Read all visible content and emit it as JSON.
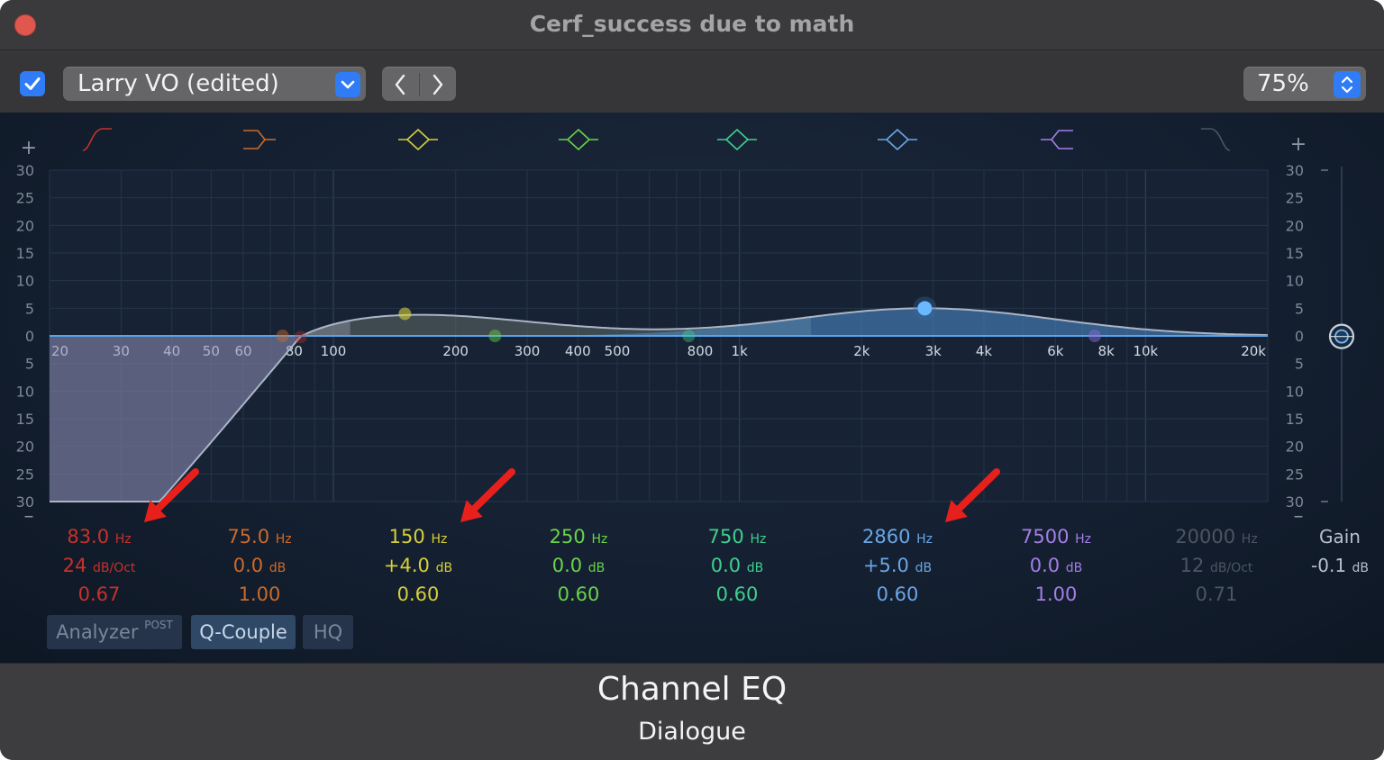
{
  "window": {
    "title": "Cerf_success due to math"
  },
  "toolbar": {
    "enabled": true,
    "preset": "Larry VO (edited)",
    "zoom": "75%"
  },
  "axis": {
    "db_left": [
      "30",
      "25",
      "20",
      "15",
      "10",
      "5",
      "0",
      "5",
      "10",
      "15",
      "20",
      "25",
      "30"
    ],
    "db_right": [
      "30",
      "25",
      "20",
      "15",
      "10",
      "5",
      "0",
      "5",
      "10",
      "15",
      "20",
      "25",
      "30"
    ],
    "plus": "+",
    "minus": "–",
    "freq_labels": [
      "20",
      "30",
      "40",
      "50",
      "60",
      "80",
      "100",
      "200",
      "300",
      "400",
      "500",
      "800",
      "1k",
      "2k",
      "3k",
      "4k",
      "6k",
      "8k",
      "10k",
      "20k"
    ]
  },
  "bands": [
    {
      "name": "Low Cut",
      "icon": "low-cut-icon",
      "color": "#c8312c",
      "freq": "83.0",
      "freq_unit": "Hz",
      "gain": "24",
      "gain_unit": "dB/Oct",
      "q": "0.67"
    },
    {
      "name": "Low Shelf",
      "icon": "low-shelf-icon",
      "color": "#cc6a2a",
      "freq": "75.0",
      "freq_unit": "Hz",
      "gain": "0.0",
      "gain_unit": "dB",
      "q": "1.00"
    },
    {
      "name": "Bell 1",
      "icon": "bell-icon",
      "color": "#d6cf3a",
      "freq": "150",
      "freq_unit": "Hz",
      "gain": "+4.0",
      "gain_unit": "dB",
      "q": "0.60"
    },
    {
      "name": "Bell 2",
      "icon": "bell-icon",
      "color": "#6ad24a",
      "freq": "250",
      "freq_unit": "Hz",
      "gain": "0.0",
      "gain_unit": "dB",
      "q": "0.60"
    },
    {
      "name": "Bell 3",
      "icon": "bell-icon",
      "color": "#3fcf8e",
      "freq": "750",
      "freq_unit": "Hz",
      "gain": "0.0",
      "gain_unit": "dB",
      "q": "0.60"
    },
    {
      "name": "Bell 4",
      "icon": "bell-icon",
      "color": "#6aa6e6",
      "freq": "2860",
      "freq_unit": "Hz",
      "gain": "+5.0",
      "gain_unit": "dB",
      "q": "0.60"
    },
    {
      "name": "High Shelf",
      "icon": "high-shelf-icon",
      "color": "#a47ee6",
      "freq": "7500",
      "freq_unit": "Hz",
      "gain": "0.0",
      "gain_unit": "dB",
      "q": "1.00"
    },
    {
      "name": "High Cut",
      "icon": "high-cut-icon",
      "color": "#4c5560",
      "freq": "20000",
      "freq_unit": "Hz",
      "gain": "12",
      "gain_unit": "dB/Oct",
      "q": "0.71"
    }
  ],
  "gain": {
    "label": "Gain",
    "value": "-0.1",
    "unit": "dB"
  },
  "options": {
    "analyzer": "Analyzer",
    "analyzer_mode": "POST",
    "q_couple": "Q-Couple",
    "hq": "HQ"
  },
  "footer": {
    "plugin": "Channel EQ",
    "track": "Dialogue"
  },
  "annotations": {
    "arrow_color": "#e8201c"
  }
}
